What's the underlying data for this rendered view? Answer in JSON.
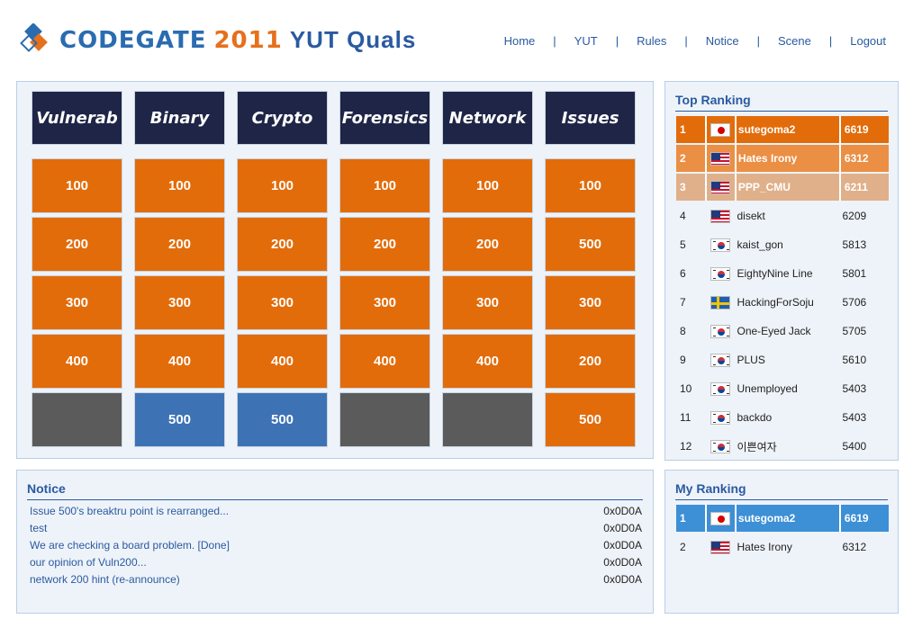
{
  "header": {
    "logo_text": "CODEGATE",
    "logo_year": "2011",
    "logo_subtitle": "YUT Quals",
    "nav": [
      "Home",
      "YUT",
      "Rules",
      "Notice",
      "Scene",
      "Logout"
    ],
    "nav_separator": "|"
  },
  "board": {
    "categories": [
      {
        "name": "Vulnerab",
        "cells": [
          {
            "value": "100",
            "state": "open"
          },
          {
            "value": "200",
            "state": "open"
          },
          {
            "value": "300",
            "state": "open"
          },
          {
            "value": "400",
            "state": "open"
          },
          {
            "value": "",
            "state": "closed"
          }
        ]
      },
      {
        "name": "Binary",
        "cells": [
          {
            "value": "100",
            "state": "open"
          },
          {
            "value": "200",
            "state": "open"
          },
          {
            "value": "300",
            "state": "open"
          },
          {
            "value": "400",
            "state": "open"
          },
          {
            "value": "500",
            "state": "solved"
          }
        ]
      },
      {
        "name": "Crypto",
        "cells": [
          {
            "value": "100",
            "state": "open"
          },
          {
            "value": "200",
            "state": "open"
          },
          {
            "value": "300",
            "state": "open"
          },
          {
            "value": "400",
            "state": "open"
          },
          {
            "value": "500",
            "state": "solved"
          }
        ]
      },
      {
        "name": "Forensics",
        "cells": [
          {
            "value": "100",
            "state": "open"
          },
          {
            "value": "200",
            "state": "open"
          },
          {
            "value": "300",
            "state": "open"
          },
          {
            "value": "400",
            "state": "open"
          },
          {
            "value": "",
            "state": "closed"
          }
        ]
      },
      {
        "name": "Network",
        "cells": [
          {
            "value": "100",
            "state": "open"
          },
          {
            "value": "200",
            "state": "open"
          },
          {
            "value": "300",
            "state": "open"
          },
          {
            "value": "400",
            "state": "open"
          },
          {
            "value": "",
            "state": "closed"
          }
        ]
      },
      {
        "name": "Issues",
        "cells": [
          {
            "value": "100",
            "state": "open"
          },
          {
            "value": "500",
            "state": "open"
          },
          {
            "value": "300",
            "state": "open"
          },
          {
            "value": "200",
            "state": "open"
          },
          {
            "value": "500",
            "state": "open"
          }
        ]
      }
    ]
  },
  "top_ranking": {
    "title": "Top Ranking",
    "rows": [
      {
        "rank": "1",
        "flag": "jp",
        "name": "sutegoma2",
        "score": "6619"
      },
      {
        "rank": "2",
        "flag": "us",
        "name": "Hates Irony",
        "score": "6312"
      },
      {
        "rank": "3",
        "flag": "us",
        "name": "PPP_CMU",
        "score": "6211"
      },
      {
        "rank": "4",
        "flag": "us",
        "name": "disekt",
        "score": "6209"
      },
      {
        "rank": "5",
        "flag": "kr",
        "name": "kaist_gon",
        "score": "5813"
      },
      {
        "rank": "6",
        "flag": "kr",
        "name": "EightyNine Line",
        "score": "5801"
      },
      {
        "rank": "7",
        "flag": "se",
        "name": "HackingForSoju",
        "score": "5706"
      },
      {
        "rank": "8",
        "flag": "kr",
        "name": "One-Eyed Jack",
        "score": "5705"
      },
      {
        "rank": "9",
        "flag": "kr",
        "name": "PLUS",
        "score": "5610"
      },
      {
        "rank": "10",
        "flag": "kr",
        "name": "Unemployed",
        "score": "5403"
      },
      {
        "rank": "11",
        "flag": "kr",
        "name": "backdo",
        "score": "5403"
      },
      {
        "rank": "12",
        "flag": "kr",
        "name": "이쁜여자",
        "score": "5400"
      }
    ],
    "highlight_colors": [
      "#e36c0a",
      "#eb8f45",
      "#e0b08a"
    ]
  },
  "notice": {
    "title": "Notice",
    "items": [
      {
        "text": "Issue 500's breaktru point is rearranged...",
        "value": "0x0D0A"
      },
      {
        "text": "test",
        "value": "0x0D0A"
      },
      {
        "text": "We are checking a board problem. [Done]",
        "value": "0x0D0A"
      },
      {
        "text": "our opinion of Vuln200...",
        "value": "0x0D0A"
      },
      {
        "text": "network 200 hint (re-announce)",
        "value": "0x0D0A"
      }
    ]
  },
  "my_ranking": {
    "title": "My Ranking",
    "rows": [
      {
        "rank": "1",
        "flag": "jp",
        "name": "sutegoma2",
        "score": "6619"
      },
      {
        "rank": "2",
        "flag": "us",
        "name": "Hates Irony",
        "score": "6312"
      }
    ],
    "highlight_color": "#3d8fd6"
  },
  "colors": {
    "accent": "#2a5aa0",
    "open_cell": "#e36c0a",
    "solved_cell": "#3d72b4",
    "closed_cell": "#5b5b5b",
    "category_bg": "#1f2546"
  }
}
